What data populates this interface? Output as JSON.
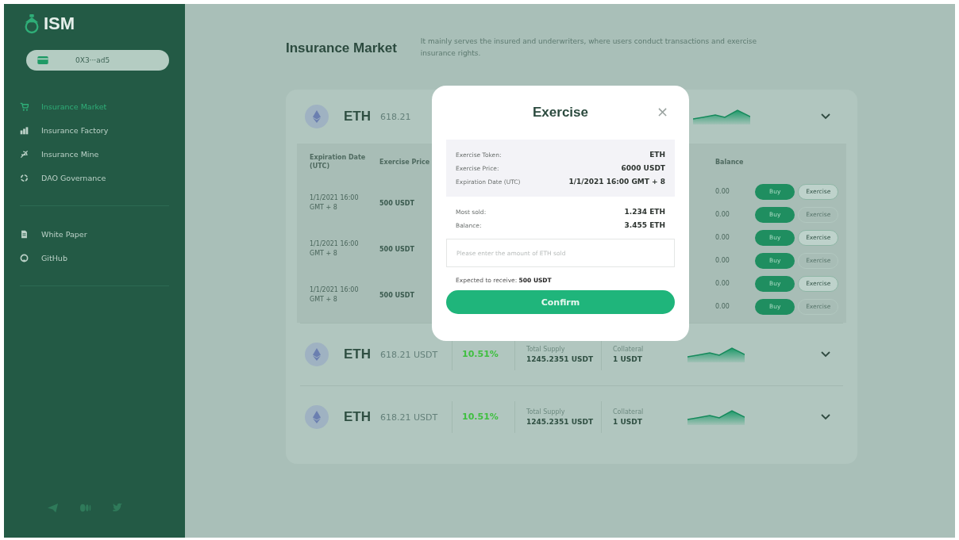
{
  "sidebar": {
    "logo": "ISM",
    "wallet": "0X3···ad5",
    "nav": [
      {
        "label": "Insurance Market",
        "selected": true
      },
      {
        "label": "Insurance Factory",
        "selected": false
      },
      {
        "label": "Insurance Mine",
        "selected": false
      },
      {
        "label": "DAO Governance",
        "selected": false
      }
    ],
    "links": [
      {
        "label": "White Paper"
      },
      {
        "label": "GitHub"
      }
    ]
  },
  "page": {
    "title": "Insurance Market",
    "description": "It mainly serves the insured and underwriters, where users conduct transactions and exercise insurance rights."
  },
  "markets": [
    {
      "token": "ETH",
      "price": "618.21",
      "table": {
        "columns": [
          "Expiration Date (UTC)",
          "Exercise Price",
          "Balance"
        ],
        "groups": [
          {
            "date": "1/1/2021 16:00 GMT + 8",
            "price": "500 USDT",
            "rows": [
              {
                "balance": "0.00",
                "buy": "Buy",
                "exercise": "Exercise",
                "disabled": false
              },
              {
                "balance": "0.00",
                "buy": "Buy",
                "exercise": "Exercise",
                "disabled": true
              }
            ]
          },
          {
            "date": "1/1/2021 16:00 GMT + 8",
            "price": "500 USDT",
            "rows": [
              {
                "balance": "0.00",
                "buy": "Buy",
                "exercise": "Exercise",
                "disabled": false
              },
              {
                "balance": "0.00",
                "buy": "Buy",
                "exercise": "Exercise",
                "disabled": true
              }
            ]
          },
          {
            "date": "1/1/2021 16:00 GMT + 8",
            "price": "500 USDT",
            "rows": [
              {
                "balance": "0.00",
                "buy": "Buy",
                "exercise": "Exercise",
                "disabled": false
              },
              {
                "balance": "0.00",
                "buy": "Buy",
                "exercise": "Exercise",
                "disabled": true
              }
            ]
          }
        ]
      }
    },
    {
      "token": "ETH",
      "price": "618.21 USDT",
      "change": "10.51%",
      "supply_label": "Total Supply",
      "supply": "1245.2351 USDT",
      "collateral_label": "Collateral",
      "collateral": "1 USDT"
    },
    {
      "token": "ETH",
      "price": "618.21 USDT",
      "change": "10.51%",
      "supply_label": "Total Supply",
      "supply": "1245.2351 USDT",
      "collateral_label": "Collateral",
      "collateral": "1 USDT"
    }
  ],
  "modal": {
    "title": "Exercise",
    "close": "×",
    "info": [
      {
        "label": "Exercise Token:",
        "value": "ETH"
      },
      {
        "label": "Exercise Price:",
        "value": "6000 USDT"
      },
      {
        "label": "Expiration Date (UTC)",
        "value": "1/1/2021 16:00 GMT + 8"
      }
    ],
    "stats": [
      {
        "label": "Most sold:",
        "value": "1.234 ETH"
      },
      {
        "label": "Balance:",
        "value": "3.455 ETH"
      }
    ],
    "input": {
      "placeholder": "Please enter the amount of ETH sold"
    },
    "expected": "Expected to receive: **500 USDT**",
    "confirm": "Confirm"
  }
}
